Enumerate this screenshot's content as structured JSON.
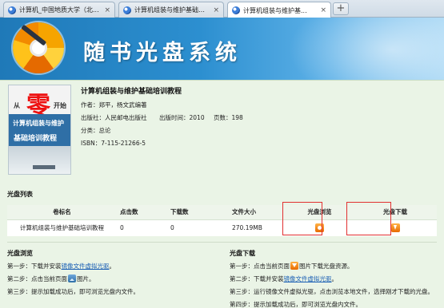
{
  "browser": {
    "tabs": [
      {
        "label": "计算机_中国地质大学（北..."
      },
      {
        "label": "计算机组装与维护基础培训..."
      },
      {
        "label": "计算机组装与维护基..."
      }
    ],
    "new_tab": "+",
    "close_glyph": "×"
  },
  "banner": {
    "title": "随书光盘系统"
  },
  "book": {
    "cover": {
      "from": "从",
      "zero": "零",
      "start": "开始",
      "line1": "计算机组装与维护",
      "line2": "基础培训教程"
    },
    "title": "计算机组装与维护基础培训教程",
    "author": "作者：郑平，杨文武编著",
    "publisher": "出版社：人民邮电出版社",
    "pub_time": "出版时间：2010",
    "pages": "页数：198",
    "category": "分类：总论",
    "isbn": "ISBN：7-115-21266-5"
  },
  "disc_list": {
    "heading": "光盘列表",
    "columns": [
      "卷标名",
      "点击数",
      "下载数",
      "文件大小",
      "光盘浏览",
      "光盘下载"
    ],
    "rows": [
      {
        "name": "计算机组装与维护基础培训教程",
        "clicks": "0",
        "downloads": "0",
        "size": "270.19MB"
      }
    ]
  },
  "browse_help": {
    "heading": "光盘浏览",
    "step1_prefix": "第一步：下载并安装",
    "step1_link": "镜像文件虚拟光驱",
    "step1_suffix": "。",
    "step2_prefix": "第二步：点击当前页面",
    "step2_suffix": "图片。",
    "step3": "第三步：提示加载成功后，即可浏览光盘内文件。"
  },
  "download_help": {
    "heading": "光盘下载",
    "step1_prefix": "第一步：点击当前页面",
    "step1_suffix": "图片下载光盘资源。",
    "step2_prefix": "第二步：下载并安装",
    "step2_link": "镜像文件虚拟光驱",
    "step2_suffix": "。",
    "step3": "第三步：运行镜像文件虚拟光驱，点击浏览本地文件，选择刚才下载的光盘。",
    "step4": "第四步：提示加载成功后，即可浏览光盘内文件。"
  }
}
